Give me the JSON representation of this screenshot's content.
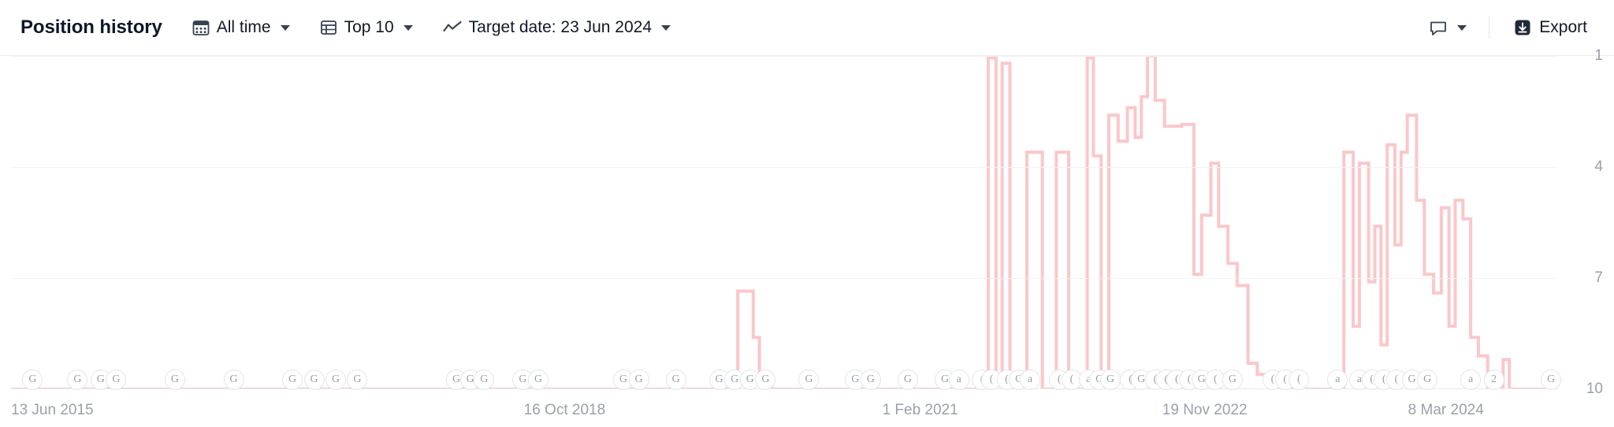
{
  "toolbar": {
    "title": "Position history",
    "range_label": "All time",
    "range_icon": "calendar-icon",
    "top_label": "Top 10",
    "top_icon": "table-icon",
    "target_date_label": "Target date: 23 Jun 2024",
    "target_date_icon": "trend-line-icon",
    "comment_icon": "comment-icon",
    "export_label": "Export",
    "export_icon": "download-icon"
  },
  "chart_data": {
    "type": "line",
    "title": "Position history",
    "xlabel": "",
    "ylabel": "",
    "ylim": [
      1,
      10
    ],
    "y_inverted": true,
    "grid": true,
    "legend_position": "none",
    "series_color": "#fbc7c9",
    "y_ticks": [
      1,
      4,
      7,
      10
    ],
    "x_ticks": [
      "13 Jun 2015",
      "16 Oct 2018",
      "1 Feb 2021",
      "19 Nov 2022",
      "8 Mar 2024"
    ],
    "x_tick_positions": [
      0.012,
      0.358,
      0.588,
      0.772,
      0.928
    ],
    "x_range": [
      "13 Jun 2015",
      "23 Jun 2024"
    ],
    "series": [
      {
        "name": "Position",
        "points": [
          [
            0.0,
            10
          ],
          [
            0.47,
            10
          ],
          [
            0.47,
            7.35
          ],
          [
            0.48,
            7.35
          ],
          [
            0.48,
            8.6
          ],
          [
            0.484,
            8.6
          ],
          [
            0.484,
            9.6
          ],
          [
            0.492,
            9.6
          ],
          [
            0.492,
            10
          ],
          [
            0.632,
            10
          ],
          [
            0.632,
            1.05
          ],
          [
            0.637,
            1.05
          ],
          [
            0.637,
            9.9
          ],
          [
            0.641,
            9.9
          ],
          [
            0.641,
            1.2
          ],
          [
            0.646,
            1.2
          ],
          [
            0.646,
            10
          ],
          [
            0.657,
            10
          ],
          [
            0.657,
            3.6
          ],
          [
            0.667,
            3.6
          ],
          [
            0.667,
            10
          ],
          [
            0.676,
            10
          ],
          [
            0.676,
            3.6
          ],
          [
            0.684,
            3.6
          ],
          [
            0.684,
            10
          ],
          [
            0.696,
            10
          ],
          [
            0.696,
            1.05
          ],
          [
            0.7,
            1.05
          ],
          [
            0.7,
            3.7
          ],
          [
            0.705,
            3.7
          ],
          [
            0.705,
            10
          ],
          [
            0.71,
            10
          ],
          [
            0.71,
            2.6
          ],
          [
            0.716,
            2.6
          ],
          [
            0.716,
            3.3
          ],
          [
            0.722,
            3.3
          ],
          [
            0.722,
            2.4
          ],
          [
            0.727,
            2.4
          ],
          [
            0.727,
            3.2
          ],
          [
            0.731,
            3.2
          ],
          [
            0.731,
            2.1
          ],
          [
            0.735,
            2.1
          ],
          [
            0.735,
            1.0
          ],
          [
            0.74,
            1.0
          ],
          [
            0.74,
            2.2
          ],
          [
            0.746,
            2.2
          ],
          [
            0.746,
            2.9
          ],
          [
            0.757,
            2.9
          ],
          [
            0.757,
            2.85
          ],
          [
            0.765,
            2.85
          ],
          [
            0.765,
            6.9
          ],
          [
            0.77,
            6.9
          ],
          [
            0.77,
            5.3
          ],
          [
            0.776,
            5.3
          ],
          [
            0.776,
            3.9
          ],
          [
            0.781,
            3.9
          ],
          [
            0.781,
            5.6
          ],
          [
            0.787,
            5.6
          ],
          [
            0.787,
            6.6
          ],
          [
            0.793,
            6.6
          ],
          [
            0.793,
            7.2
          ],
          [
            0.8,
            7.2
          ],
          [
            0.8,
            9.3
          ],
          [
            0.806,
            9.3
          ],
          [
            0.806,
            9.6
          ],
          [
            0.815,
            9.6
          ],
          [
            0.815,
            10
          ],
          [
            0.862,
            10
          ],
          [
            0.862,
            3.6
          ],
          [
            0.868,
            3.6
          ],
          [
            0.868,
            8.3
          ],
          [
            0.872,
            8.3
          ],
          [
            0.872,
            3.9
          ],
          [
            0.878,
            3.9
          ],
          [
            0.878,
            7.1
          ],
          [
            0.882,
            7.1
          ],
          [
            0.882,
            5.6
          ],
          [
            0.886,
            5.6
          ],
          [
            0.886,
            8.8
          ],
          [
            0.89,
            8.8
          ],
          [
            0.89,
            3.4
          ],
          [
            0.895,
            3.4
          ],
          [
            0.895,
            6.1
          ],
          [
            0.899,
            6.1
          ],
          [
            0.899,
            3.6
          ],
          [
            0.903,
            3.6
          ],
          [
            0.903,
            2.6
          ],
          [
            0.909,
            2.6
          ],
          [
            0.909,
            4.9
          ],
          [
            0.914,
            4.9
          ],
          [
            0.914,
            6.9
          ],
          [
            0.92,
            6.9
          ],
          [
            0.92,
            7.4
          ],
          [
            0.925,
            7.4
          ],
          [
            0.925,
            5.1
          ],
          [
            0.93,
            5.1
          ],
          [
            0.93,
            8.3
          ],
          [
            0.934,
            8.3
          ],
          [
            0.934,
            4.9
          ],
          [
            0.939,
            4.9
          ],
          [
            0.939,
            5.4
          ],
          [
            0.944,
            5.4
          ],
          [
            0.944,
            8.6
          ],
          [
            0.949,
            8.6
          ],
          [
            0.949,
            9.1
          ],
          [
            0.955,
            9.1
          ],
          [
            0.955,
            10
          ],
          [
            0.965,
            10
          ],
          [
            0.965,
            9.2
          ],
          [
            0.969,
            9.2
          ],
          [
            0.969,
            10
          ],
          [
            1.0,
            10
          ]
        ]
      }
    ],
    "serp_markers": [
      {
        "x": 0.014,
        "glyph": "G"
      },
      {
        "x": 0.043,
        "glyph": "G"
      },
      {
        "x": 0.058,
        "glyph": "G"
      },
      {
        "x": 0.068,
        "glyph": "G"
      },
      {
        "x": 0.106,
        "glyph": "G"
      },
      {
        "x": 0.144,
        "glyph": "G"
      },
      {
        "x": 0.182,
        "glyph": "G"
      },
      {
        "x": 0.196,
        "glyph": "G"
      },
      {
        "x": 0.21,
        "glyph": "G"
      },
      {
        "x": 0.224,
        "glyph": "G"
      },
      {
        "x": 0.288,
        "glyph": "G"
      },
      {
        "x": 0.297,
        "glyph": "G"
      },
      {
        "x": 0.306,
        "glyph": "G"
      },
      {
        "x": 0.331,
        "glyph": "G"
      },
      {
        "x": 0.341,
        "glyph": "G"
      },
      {
        "x": 0.396,
        "glyph": "G"
      },
      {
        "x": 0.406,
        "glyph": "G"
      },
      {
        "x": 0.43,
        "glyph": "G"
      },
      {
        "x": 0.458,
        "glyph": "G"
      },
      {
        "x": 0.468,
        "glyph": "G"
      },
      {
        "x": 0.478,
        "glyph": "G"
      },
      {
        "x": 0.488,
        "glyph": "G"
      },
      {
        "x": 0.516,
        "glyph": "G"
      },
      {
        "x": 0.546,
        "glyph": "G"
      },
      {
        "x": 0.556,
        "glyph": "G"
      },
      {
        "x": 0.58,
        "glyph": "G"
      },
      {
        "x": 0.604,
        "glyph": "G"
      },
      {
        "x": 0.613,
        "glyph": "a"
      },
      {
        "x": 0.628,
        "glyph": "("
      },
      {
        "x": 0.634,
        "glyph": "("
      },
      {
        "x": 0.644,
        "glyph": "("
      },
      {
        "x": 0.652,
        "glyph": "G"
      },
      {
        "x": 0.659,
        "glyph": "a"
      },
      {
        "x": 0.678,
        "glyph": "("
      },
      {
        "x": 0.686,
        "glyph": "("
      },
      {
        "x": 0.697,
        "glyph": "a"
      },
      {
        "x": 0.704,
        "glyph": "G"
      },
      {
        "x": 0.711,
        "glyph": "G"
      },
      {
        "x": 0.724,
        "glyph": "("
      },
      {
        "x": 0.731,
        "glyph": "G"
      },
      {
        "x": 0.74,
        "glyph": "("
      },
      {
        "x": 0.747,
        "glyph": "("
      },
      {
        "x": 0.754,
        "glyph": "("
      },
      {
        "x": 0.762,
        "glyph": "("
      },
      {
        "x": 0.77,
        "glyph": "G"
      },
      {
        "x": 0.779,
        "glyph": "("
      },
      {
        "x": 0.79,
        "glyph": "G"
      },
      {
        "x": 0.816,
        "glyph": "("
      },
      {
        "x": 0.824,
        "glyph": "("
      },
      {
        "x": 0.833,
        "glyph": "("
      },
      {
        "x": 0.858,
        "glyph": "a"
      },
      {
        "x": 0.872,
        "glyph": "a"
      },
      {
        "x": 0.88,
        "glyph": "("
      },
      {
        "x": 0.888,
        "glyph": "("
      },
      {
        "x": 0.896,
        "glyph": "("
      },
      {
        "x": 0.906,
        "glyph": "G"
      },
      {
        "x": 0.916,
        "glyph": "G"
      },
      {
        "x": 0.944,
        "glyph": "a"
      },
      {
        "x": 0.959,
        "glyph": "2"
      },
      {
        "x": 0.996,
        "glyph": "G"
      }
    ]
  }
}
